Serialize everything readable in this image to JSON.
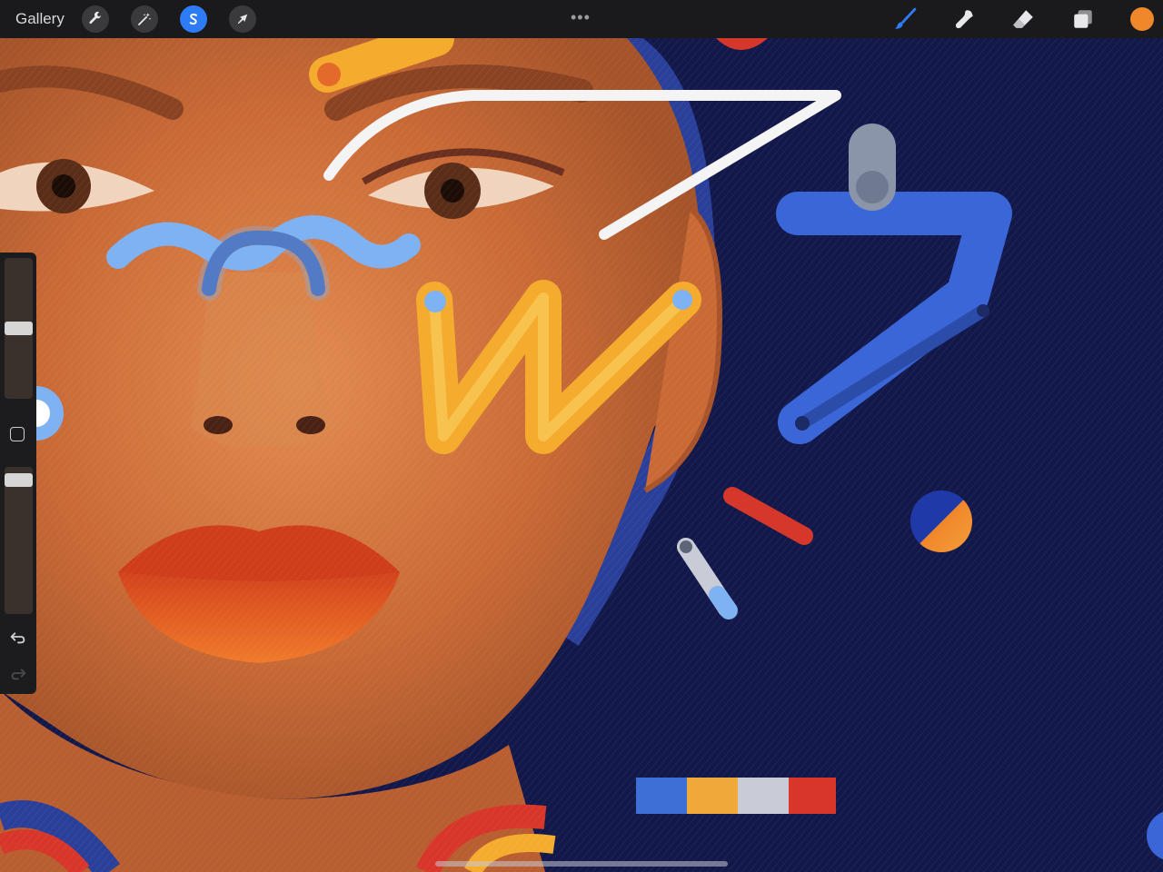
{
  "toolbar": {
    "gallery_label": "Gallery",
    "left_tools": [
      {
        "name": "actions",
        "icon": "wrench-icon",
        "active": false
      },
      {
        "name": "adjustments",
        "icon": "magic-wand-icon",
        "active": false
      },
      {
        "name": "selection",
        "icon": "selection-s-icon",
        "active": true
      },
      {
        "name": "transform",
        "icon": "arrow-cursor-icon",
        "active": false
      }
    ],
    "more_label": "•••",
    "right_tools": [
      {
        "name": "brush",
        "icon": "brush-icon",
        "active": true
      },
      {
        "name": "smudge",
        "icon": "smudge-icon",
        "active": false
      },
      {
        "name": "eraser",
        "icon": "eraser-icon",
        "active": false
      },
      {
        "name": "layers",
        "icon": "layers-icon",
        "active": false
      }
    ],
    "current_color": "#f0872a"
  },
  "sidebar": {
    "brush_size_level": 0.5,
    "opacity_level": 0.95,
    "modifier_icon": "square-icon",
    "undo_icon": "undo-icon",
    "redo_icon": "redo-icon"
  },
  "canvas": {
    "palette_swatches": [
      "#3d6fd6",
      "#f0a838",
      "#c9ccd6",
      "#d8362a"
    ],
    "background_color": "#13184a",
    "accent_colors": {
      "blue": "#3a66d8",
      "light_blue": "#7eb2f2",
      "yellow": "#f5ac2e",
      "red": "#d5382a",
      "white": "#f4f4f4"
    }
  }
}
